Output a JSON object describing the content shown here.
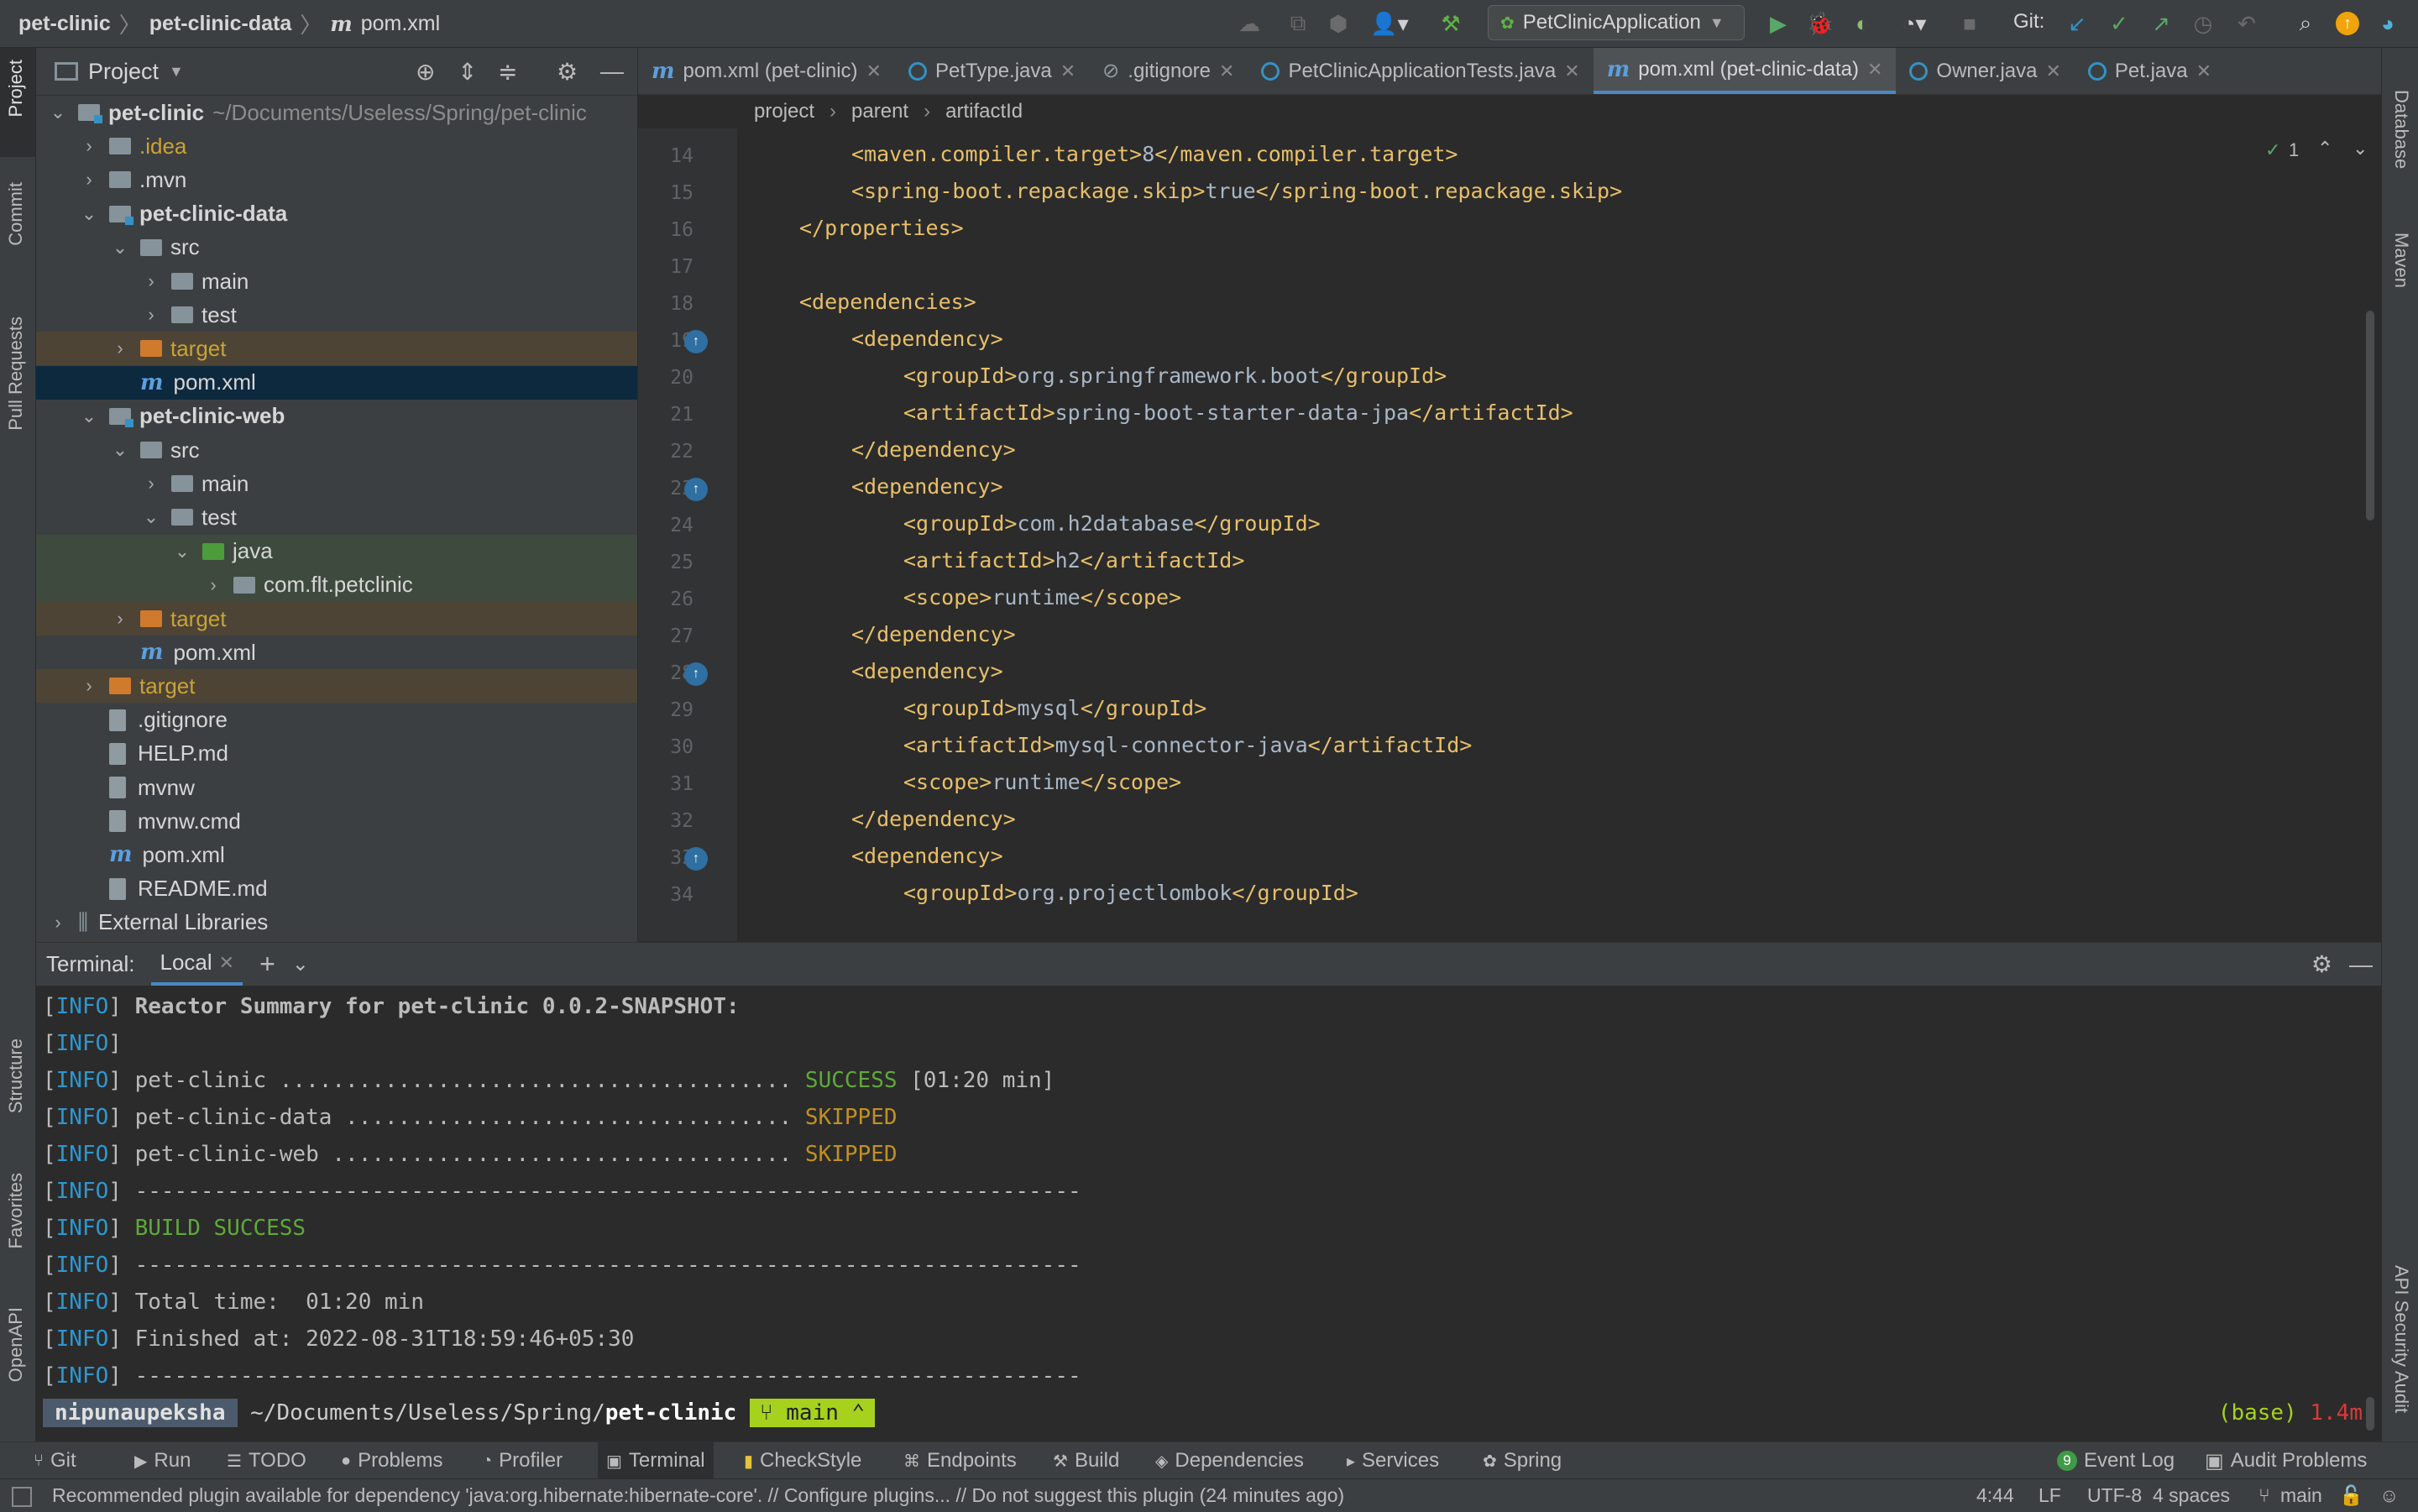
{
  "titlebar": {
    "crumbs": [
      "pet-clinic",
      "pet-clinic-data",
      "pom.xml"
    ],
    "run_config": "PetClinicApplication",
    "git_label": "Git:"
  },
  "project": {
    "title": "Project",
    "tree": [
      {
        "label": "pet-clinic",
        "suffix": "~/Documents/Useless/Spring/pet-clinic",
        "depth": 0,
        "arrow": "v",
        "kind": "module",
        "bold": true
      },
      {
        "label": ".idea",
        "depth": 1,
        "arrow": ">",
        "kind": "folder",
        "style": "yellow"
      },
      {
        "label": ".mvn",
        "depth": 1,
        "arrow": ">",
        "kind": "folder"
      },
      {
        "label": "pet-clinic-data",
        "depth": 1,
        "arrow": "v",
        "kind": "module",
        "bold": true
      },
      {
        "label": "src",
        "depth": 2,
        "arrow": "v",
        "kind": "folder"
      },
      {
        "label": "main",
        "depth": 3,
        "arrow": ">",
        "kind": "folder"
      },
      {
        "label": "test",
        "depth": 3,
        "arrow": ">",
        "kind": "folder"
      },
      {
        "label": "target",
        "depth": 2,
        "arrow": ">",
        "kind": "orange",
        "style": "yellow",
        "bg": "orange"
      },
      {
        "label": "pom.xml",
        "depth": 2,
        "arrow": "",
        "kind": "maven",
        "bg": "selected"
      },
      {
        "label": "pet-clinic-web",
        "depth": 1,
        "arrow": "v",
        "kind": "module",
        "bold": true
      },
      {
        "label": "src",
        "depth": 2,
        "arrow": "v",
        "kind": "folder"
      },
      {
        "label": "main",
        "depth": 3,
        "arrow": ">",
        "kind": "folder"
      },
      {
        "label": "test",
        "depth": 3,
        "arrow": "v",
        "kind": "folder"
      },
      {
        "label": "java",
        "depth": 4,
        "arrow": "v",
        "kind": "green",
        "bg": "green"
      },
      {
        "label": "com.flt.petclinic",
        "depth": 5,
        "arrow": ">",
        "kind": "package",
        "bg": "green"
      },
      {
        "label": "target",
        "depth": 2,
        "arrow": ">",
        "kind": "orange",
        "style": "yellow",
        "bg": "orange"
      },
      {
        "label": "pom.xml",
        "depth": 2,
        "arrow": "",
        "kind": "maven"
      },
      {
        "label": "target",
        "depth": 1,
        "arrow": ">",
        "kind": "orange",
        "style": "yellow",
        "bg": "orange"
      },
      {
        "label": ".gitignore",
        "depth": 1,
        "arrow": "",
        "kind": "file"
      },
      {
        "label": "HELP.md",
        "depth": 1,
        "arrow": "",
        "kind": "file"
      },
      {
        "label": "mvnw",
        "depth": 1,
        "arrow": "",
        "kind": "file"
      },
      {
        "label": "mvnw.cmd",
        "depth": 1,
        "arrow": "",
        "kind": "file"
      },
      {
        "label": "pom.xml",
        "depth": 1,
        "arrow": "",
        "kind": "maven"
      },
      {
        "label": "README.md",
        "depth": 1,
        "arrow": "",
        "kind": "file"
      },
      {
        "label": "External Libraries",
        "depth": 0,
        "arrow": ">",
        "kind": "libs"
      }
    ]
  },
  "tabs": [
    {
      "label": "pom.xml (pet-clinic)",
      "icon": "maven",
      "active": false
    },
    {
      "label": "PetType.java",
      "icon": "class",
      "active": false
    },
    {
      "label": ".gitignore",
      "icon": "file",
      "active": false
    },
    {
      "label": "PetClinicApplicationTests.java",
      "icon": "class",
      "active": false
    },
    {
      "label": "pom.xml (pet-clinic-data)",
      "icon": "maven",
      "active": true
    },
    {
      "label": "Owner.java",
      "icon": "class",
      "active": false
    },
    {
      "label": "Pet.java",
      "icon": "class",
      "active": false
    }
  ],
  "breadcrumb": [
    "project",
    "parent",
    "artifactId"
  ],
  "inspection_count": "1",
  "code_lines": [
    {
      "n": "14",
      "indent": 1,
      "open": "maven.compiler.target",
      "text": "8",
      "close": "maven.compiler.target"
    },
    {
      "n": "15",
      "indent": 1,
      "open": "spring-boot.repackage.skip",
      "text": "true",
      "close": "spring-boot.repackage.skip"
    },
    {
      "n": "16",
      "indent": 0,
      "close": "properties"
    },
    {
      "n": "17",
      "indent": 0
    },
    {
      "n": "18",
      "indent": 0,
      "open": "dependencies"
    },
    {
      "n": "19",
      "indent": 1,
      "open": "dependency",
      "gutter": true
    },
    {
      "n": "20",
      "indent": 2,
      "open": "groupId",
      "text": "org.springframework.boot",
      "close": "groupId"
    },
    {
      "n": "21",
      "indent": 2,
      "open": "artifactId",
      "text": "spring-boot-starter-data-jpa",
      "close": "artifactId"
    },
    {
      "n": "22",
      "indent": 1,
      "close": "dependency"
    },
    {
      "n": "23",
      "indent": 1,
      "open": "dependency",
      "gutter": true
    },
    {
      "n": "24",
      "indent": 2,
      "open": "groupId",
      "text": "com.h2database",
      "close": "groupId"
    },
    {
      "n": "25",
      "indent": 2,
      "open": "artifactId",
      "text": "h2",
      "close": "artifactId"
    },
    {
      "n": "26",
      "indent": 2,
      "open": "scope",
      "text": "runtime",
      "close": "scope"
    },
    {
      "n": "27",
      "indent": 1,
      "close": "dependency"
    },
    {
      "n": "28",
      "indent": 1,
      "open": "dependency",
      "gutter": true
    },
    {
      "n": "29",
      "indent": 2,
      "open": "groupId",
      "text": "mysql",
      "close": "groupId"
    },
    {
      "n": "30",
      "indent": 2,
      "open": "artifactId",
      "text": "mysql-connector-java",
      "close": "artifactId"
    },
    {
      "n": "31",
      "indent": 2,
      "open": "scope",
      "text": "runtime",
      "close": "scope"
    },
    {
      "n": "32",
      "indent": 1,
      "close": "dependency"
    },
    {
      "n": "33",
      "indent": 1,
      "open": "dependency",
      "gutter": true
    },
    {
      "n": "34",
      "indent": 2,
      "open": "groupId",
      "text": "org.projectlombok",
      "close": "groupId"
    }
  ],
  "terminal": {
    "title": "Terminal:",
    "tab": "Local",
    "lines": [
      {
        "tag": "INFO",
        "parts": [
          {
            "t": "Reactor Summary for pet-clinic 0.0.2-SNAPSHOT:",
            "c": "bold"
          }
        ]
      },
      {
        "tag": "INFO",
        "parts": []
      },
      {
        "tag": "INFO",
        "parts": [
          {
            "t": "pet-clinic ....................................... ",
            "c": ""
          },
          {
            "t": "SUCCESS",
            "c": "succ"
          },
          {
            "t": " [01:20 min]",
            "c": ""
          }
        ]
      },
      {
        "tag": "INFO",
        "parts": [
          {
            "t": "pet-clinic-data .................................. ",
            "c": ""
          },
          {
            "t": "SKIPPED",
            "c": "skip"
          }
        ]
      },
      {
        "tag": "INFO",
        "parts": [
          {
            "t": "pet-clinic-web ................................... ",
            "c": ""
          },
          {
            "t": "SKIPPED",
            "c": "skip"
          }
        ]
      },
      {
        "tag": "INFO",
        "parts": [
          {
            "t": "------------------------------------------------------------------------",
            "c": ""
          }
        ]
      },
      {
        "tag": "INFO",
        "parts": [
          {
            "t": "BUILD SUCCESS",
            "c": "succ"
          }
        ]
      },
      {
        "tag": "INFO",
        "parts": [
          {
            "t": "------------------------------------------------------------------------",
            "c": ""
          }
        ]
      },
      {
        "tag": "INFO",
        "parts": [
          {
            "t": "Total time:  01:20 min",
            "c": ""
          }
        ]
      },
      {
        "tag": "INFO",
        "parts": [
          {
            "t": "Finished at: 2022-08-31T18:59:46+05:30",
            "c": ""
          }
        ]
      },
      {
        "tag": "INFO",
        "parts": [
          {
            "t": "------------------------------------------------------------------------",
            "c": ""
          }
        ]
      }
    ],
    "prompt": {
      "user": "nipunaupeksha",
      "path_prefix": "~/Documents/Useless/Spring/",
      "path_dir": "pet-clinic",
      "branch": "main",
      "env": "(base)",
      "time": "1.4m"
    }
  },
  "left_strip": [
    "Project",
    "Commit",
    "Pull Requests",
    "Structure",
    "Favorites",
    "OpenAPI"
  ],
  "right_strip": [
    "Database",
    "Maven",
    "API Security Audit"
  ],
  "bottom_tools": [
    "Git",
    "Run",
    "TODO",
    "Problems",
    "Profiler",
    "Terminal",
    "CheckStyle",
    "Endpoints",
    "Build",
    "Dependencies",
    "Services",
    "Spring"
  ],
  "bottom_right": {
    "event_log": "Event Log",
    "event_count": "9",
    "audit": "Audit Problems"
  },
  "status": {
    "message": "Recommended plugin available for dependency 'java:org.hibernate:hibernate-core'. // Configure plugins... // Do not suggest this plugin (24 minutes ago)",
    "position": "4:44",
    "line_sep": "LF",
    "encoding": "UTF-8",
    "indent": "4 spaces",
    "branch": "main"
  }
}
